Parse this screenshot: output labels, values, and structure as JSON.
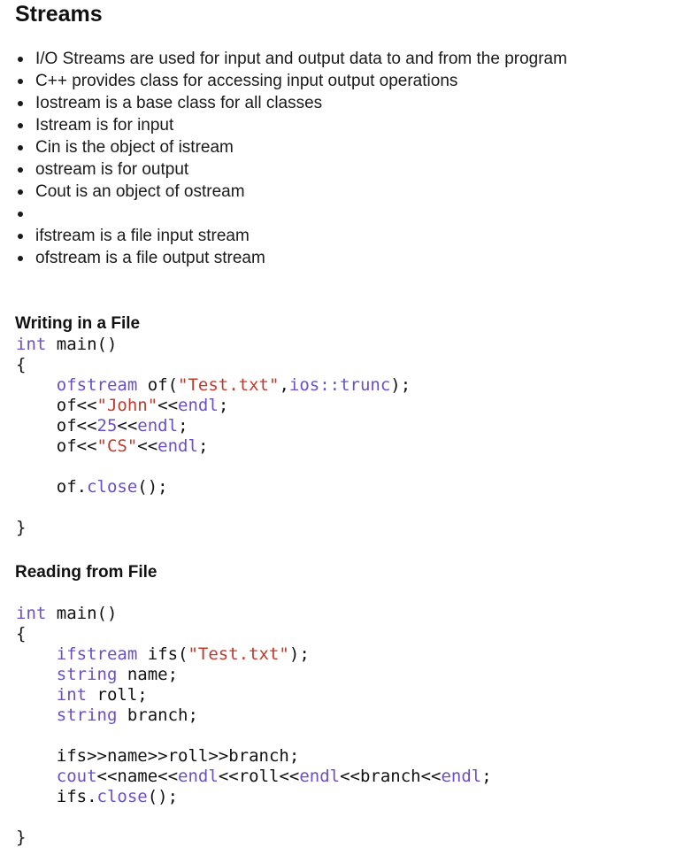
{
  "title": "Streams",
  "bullets": [
    "I/O Streams are used for input and output data to and from the program",
    "C++ provides class for accessing input output operations",
    "Iostream is a base class for all classes",
    "Istream is for input",
    "Cin is the object of istream",
    "ostream is for output",
    "Cout is an object of ostream",
    "",
    "ifstream is a file input stream",
    "ofstream is a file output stream"
  ],
  "sections": {
    "writing": {
      "heading": "Writing in a File",
      "code": [
        [
          [
            "kw",
            "int"
          ],
          [
            "pl",
            " main()"
          ]
        ],
        [
          [
            "pl",
            "{"
          ]
        ],
        [
          [
            "pl",
            "    "
          ],
          [
            "kw",
            "ofstream"
          ],
          [
            "pl",
            " of("
          ],
          [
            "str",
            "\"Test.txt\""
          ],
          [
            "pl",
            ","
          ],
          [
            "kw",
            "ios::trunc"
          ],
          [
            "pl",
            ");"
          ]
        ],
        [
          [
            "pl",
            "    of<<"
          ],
          [
            "str",
            "\"John\""
          ],
          [
            "pl",
            "<<"
          ],
          [
            "kw",
            "endl"
          ],
          [
            "pl",
            ";"
          ]
        ],
        [
          [
            "pl",
            "    of<<"
          ],
          [
            "num",
            "25"
          ],
          [
            "pl",
            "<<"
          ],
          [
            "kw",
            "endl"
          ],
          [
            "pl",
            ";"
          ]
        ],
        [
          [
            "pl",
            "    of<<"
          ],
          [
            "str",
            "\"CS\""
          ],
          [
            "pl",
            "<<"
          ],
          [
            "kw",
            "endl"
          ],
          [
            "pl",
            ";"
          ]
        ],
        [
          [
            "pl",
            ""
          ]
        ],
        [
          [
            "pl",
            "    of."
          ],
          [
            "kw",
            "close"
          ],
          [
            "pl",
            "();"
          ]
        ],
        [
          [
            "pl",
            ""
          ]
        ],
        [
          [
            "pl",
            "}"
          ]
        ]
      ]
    },
    "reading": {
      "heading": "Reading from File",
      "code": [
        [
          [
            "kw",
            "int"
          ],
          [
            "pl",
            " main()"
          ]
        ],
        [
          [
            "pl",
            "{"
          ]
        ],
        [
          [
            "pl",
            "    "
          ],
          [
            "kw",
            "ifstream"
          ],
          [
            "pl",
            " ifs("
          ],
          [
            "str",
            "\"Test.txt\""
          ],
          [
            "pl",
            ");"
          ]
        ],
        [
          [
            "pl",
            "    "
          ],
          [
            "kw",
            "string"
          ],
          [
            "pl",
            " name;"
          ]
        ],
        [
          [
            "pl",
            "    "
          ],
          [
            "kw",
            "int"
          ],
          [
            "pl",
            " roll;"
          ]
        ],
        [
          [
            "pl",
            "    "
          ],
          [
            "kw",
            "string"
          ],
          [
            "pl",
            " branch;"
          ]
        ],
        [
          [
            "pl",
            ""
          ]
        ],
        [
          [
            "pl",
            "    ifs>>name>>roll>>branch;"
          ]
        ],
        [
          [
            "pl",
            "    "
          ],
          [
            "kw",
            "cout"
          ],
          [
            "pl",
            "<<name<<"
          ],
          [
            "kw",
            "endl"
          ],
          [
            "pl",
            "<<roll<<"
          ],
          [
            "kw",
            "endl"
          ],
          [
            "pl",
            "<<branch<<"
          ],
          [
            "kw",
            "endl"
          ],
          [
            "pl",
            ";"
          ]
        ],
        [
          [
            "pl",
            "    ifs."
          ],
          [
            "kw",
            "close"
          ],
          [
            "pl",
            "();"
          ]
        ],
        [
          [
            "pl",
            ""
          ]
        ],
        [
          [
            "pl",
            "}"
          ]
        ]
      ]
    }
  }
}
